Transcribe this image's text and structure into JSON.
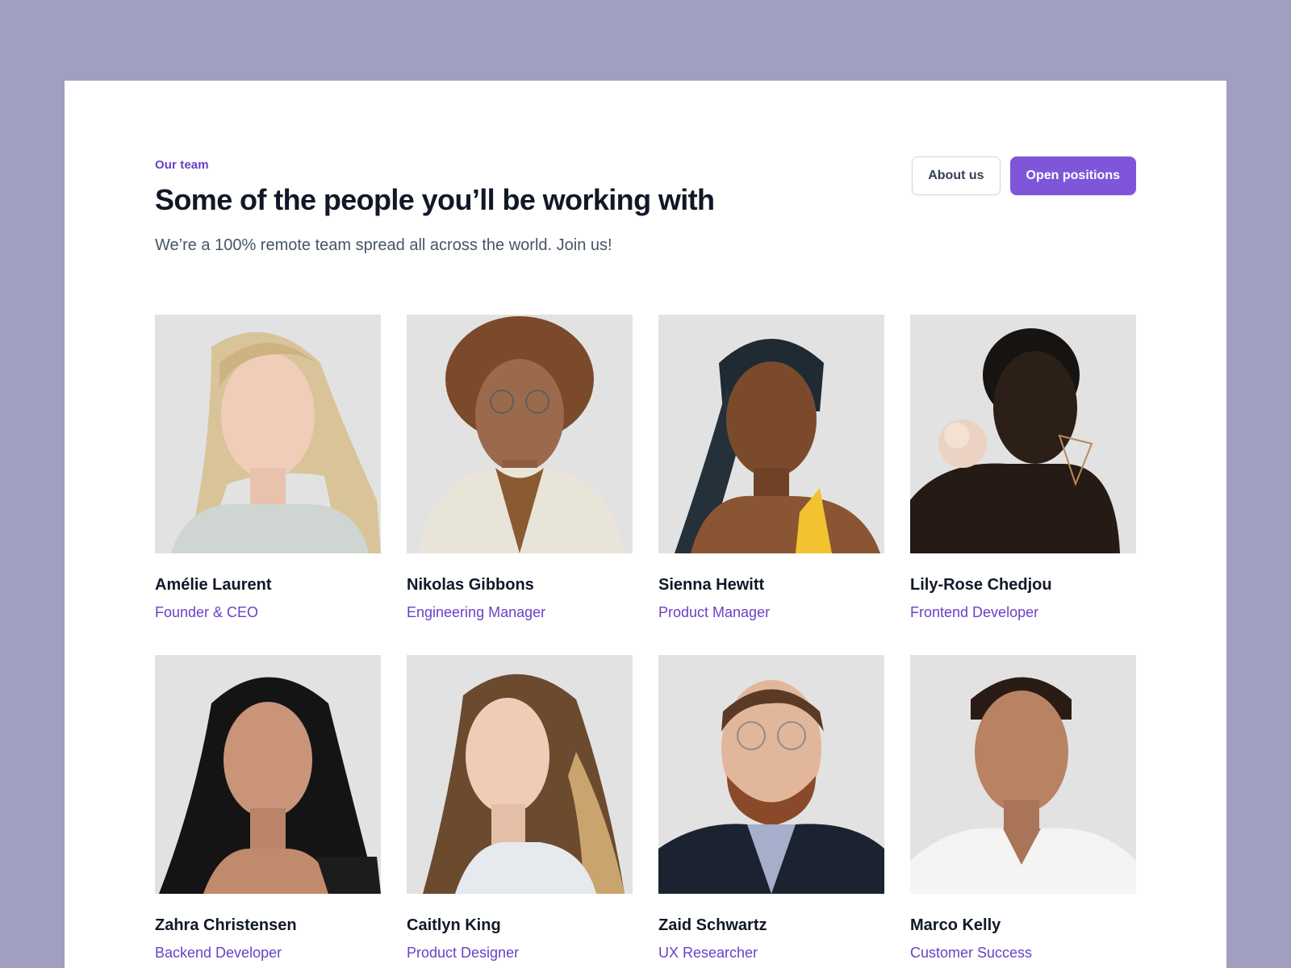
{
  "header": {
    "eyebrow": "Our team",
    "title": "Some of the people you’ll be working with",
    "subtitle": "We’re a 100% remote team spread all across the world. Join us!"
  },
  "actions": {
    "about_label": "About us",
    "open_positions_label": "Open positions"
  },
  "colors": {
    "background": "#a09fc0",
    "accent": "#7f56d9",
    "role_text": "#6941c6",
    "photo_bg": "#e4e4e4"
  },
  "team": [
    {
      "name": "Amélie Laurent",
      "role": "Founder & CEO"
    },
    {
      "name": "Nikolas Gibbons",
      "role": "Engineering Manager"
    },
    {
      "name": "Sienna Hewitt",
      "role": "Product Manager"
    },
    {
      "name": "Lily-Rose Chedjou",
      "role": "Frontend Developer"
    },
    {
      "name": "Zahra Christensen",
      "role": "Backend Developer"
    },
    {
      "name": "Caitlyn King",
      "role": "Product Designer"
    },
    {
      "name": "Zaid Schwartz",
      "role": "UX Researcher"
    },
    {
      "name": "Marco Kelly",
      "role": "Customer Success"
    }
  ]
}
